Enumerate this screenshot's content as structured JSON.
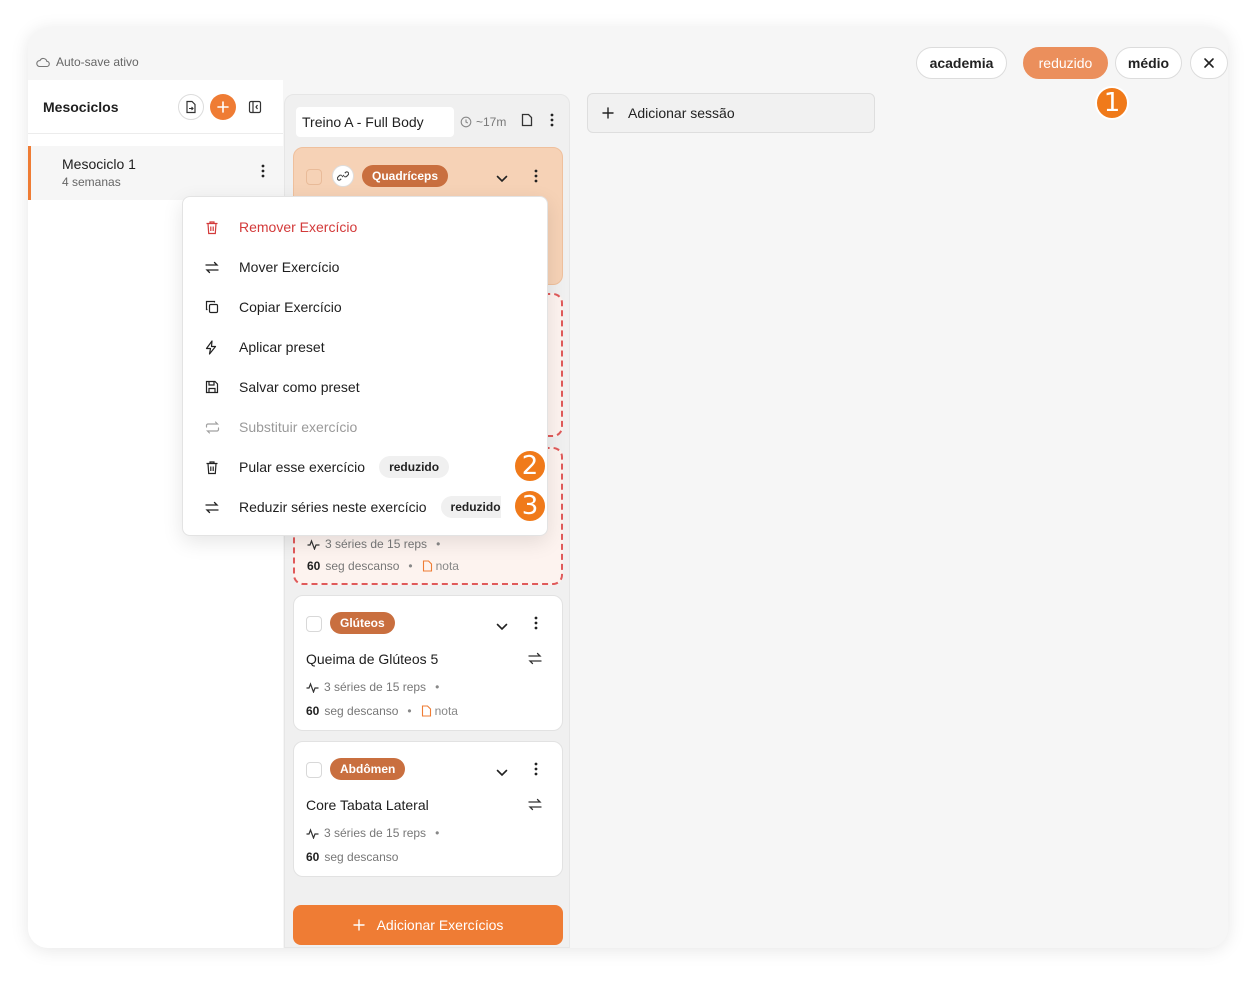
{
  "topbar": {
    "autosave": "Auto-save ativo",
    "modes": [
      {
        "label": "academia",
        "active": false
      },
      {
        "label": "reduzido",
        "active": true
      },
      {
        "label": "médio",
        "active": false
      }
    ]
  },
  "markers": [
    "1",
    "2",
    "3"
  ],
  "sidebar": {
    "title": "Mesociclos",
    "items": [
      {
        "name": "Mesociclo 1",
        "sub": "4 semanas"
      }
    ]
  },
  "session": {
    "title": "Treino A - Full Body",
    "time": "~17m",
    "cards": [
      {
        "tag": "Quadríceps"
      },
      {
        "meta1": "3 séries de 15 reps",
        "rest_value": "60",
        "rest_label": "seg descanso",
        "note": "nota"
      },
      {
        "tag": "Glúteos",
        "name": "Queima de Glúteos 5",
        "meta1": "3 séries de 15 reps",
        "rest_value": "60",
        "rest_label": "seg descanso",
        "note": "nota"
      },
      {
        "tag": "Abdômen",
        "name": "Core Tabata Lateral",
        "meta1": "3 séries de 15 reps",
        "rest_value": "60",
        "rest_label": "seg descanso"
      }
    ],
    "add_exercises": "Adicionar Exercícios"
  },
  "add_session": "Adicionar sessão",
  "menu": {
    "items": [
      {
        "label": "Remover Exercício",
        "icon": "trash-icon",
        "style": "danger"
      },
      {
        "label": "Mover Exercício",
        "icon": "arrows-swap-icon"
      },
      {
        "label": "Copiar Exercício",
        "icon": "copy-icon"
      },
      {
        "label": "Aplicar preset",
        "icon": "bolt-icon"
      },
      {
        "label": "Salvar como preset",
        "icon": "save-icon"
      },
      {
        "label": "Substituir exercício",
        "icon": "replace-icon",
        "style": "disabled"
      },
      {
        "label": "Pular esse exercício",
        "icon": "trash-icon",
        "badge": "reduzido"
      },
      {
        "label": "Reduzir séries neste exercício",
        "icon": "arrows-swap-icon",
        "badge": "reduzido"
      }
    ]
  },
  "colors": {
    "accent": "#ef7c34",
    "active_pill": "#eb8f5c",
    "tag": "#c96f3f",
    "danger": "#d33a3a",
    "marker": "#f07a1a"
  }
}
